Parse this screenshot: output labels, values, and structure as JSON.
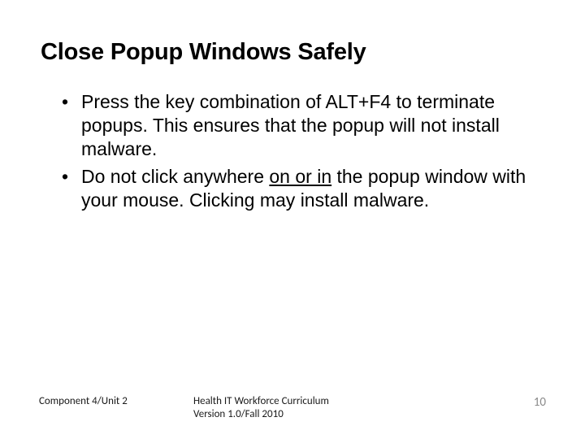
{
  "title": "Close Popup Windows Safely",
  "bullets": [
    {
      "text_before": "Press the key combination of ALT+F4 to terminate popups. This ensures that the popup will not install malware.",
      "underline": "",
      "text_after": ""
    },
    {
      "text_before": "Do not click anywhere ",
      "underline": "on or in",
      "text_after": " the popup window with your mouse. Clicking may install malware."
    }
  ],
  "footer": {
    "left": "Component 4/Unit 2",
    "center_line1": "Health IT Workforce Curriculum",
    "center_line2": "Version 1.0/Fall 2010",
    "page_number": "10"
  }
}
